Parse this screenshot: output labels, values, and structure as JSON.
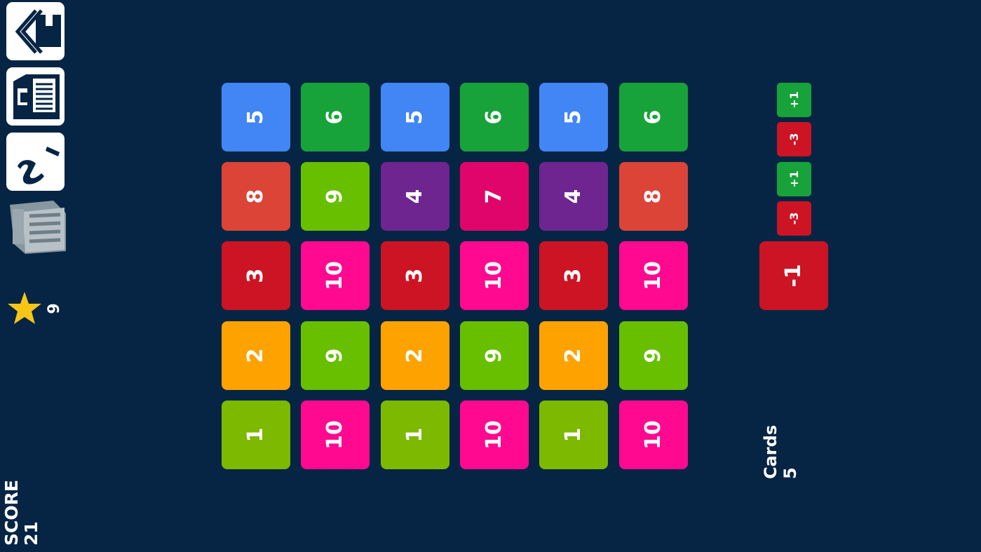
{
  "sidebar": {
    "home_icon": "home-icon",
    "save_icon": "save-icon",
    "info_icon": "info-icon",
    "trash_icon": "trash-icon",
    "star_icon": "star-icon",
    "stars_count": "9"
  },
  "score": {
    "label": "SCORE",
    "value": "21"
  },
  "cards": {
    "label": "Cards",
    "value": "5"
  },
  "colors": {
    "background": "#062544",
    "blue": "#4285f4",
    "green": "#17a339",
    "red_orange": "#db4437",
    "lime": "#67bf00",
    "purple": "#6f2590",
    "crimson": "#e0056b",
    "red": "#cc1425",
    "magenta": "#ff0991",
    "orange": "#fea200",
    "light_green": "#7cb900",
    "star": "#f5c518"
  },
  "grid": [
    [
      {
        "value": "5",
        "color": "#4285f4"
      },
      {
        "value": "6",
        "color": "#17a339"
      },
      {
        "value": "5",
        "color": "#4285f4"
      },
      {
        "value": "6",
        "color": "#17a339"
      },
      {
        "value": "5",
        "color": "#4285f4"
      },
      {
        "value": "6",
        "color": "#17a339"
      }
    ],
    [
      {
        "value": "8",
        "color": "#db4437"
      },
      {
        "value": "9",
        "color": "#67bf00"
      },
      {
        "value": "4",
        "color": "#6f2590"
      },
      {
        "value": "7",
        "color": "#e0056b"
      },
      {
        "value": "4",
        "color": "#6f2590"
      },
      {
        "value": "8",
        "color": "#db4437"
      }
    ],
    [
      {
        "value": "3",
        "color": "#cc1425"
      },
      {
        "value": "10",
        "color": "#ff0991"
      },
      {
        "value": "3",
        "color": "#cc1425"
      },
      {
        "value": "10",
        "color": "#ff0991"
      },
      {
        "value": "3",
        "color": "#cc1425"
      },
      {
        "value": "10",
        "color": "#ff0991"
      }
    ],
    [
      {
        "value": "2",
        "color": "#fea200"
      },
      {
        "value": "9",
        "color": "#67bf00"
      },
      {
        "value": "2",
        "color": "#fea200"
      },
      {
        "value": "9",
        "color": "#67bf00"
      },
      {
        "value": "2",
        "color": "#fea200"
      },
      {
        "value": "9",
        "color": "#67bf00"
      }
    ],
    [
      {
        "value": "1",
        "color": "#7cb900"
      },
      {
        "value": "10",
        "color": "#ff0991"
      },
      {
        "value": "1",
        "color": "#7cb900"
      },
      {
        "value": "10",
        "color": "#ff0991"
      },
      {
        "value": "1",
        "color": "#7cb900"
      },
      {
        "value": "10",
        "color": "#ff0991"
      }
    ]
  ],
  "queue": [
    {
      "value": "+1",
      "color": "#17a339"
    },
    {
      "value": "-3",
      "color": "#cc1425"
    },
    {
      "value": "+1",
      "color": "#17a339"
    },
    {
      "value": "-3",
      "color": "#cc1425"
    }
  ],
  "current_card": {
    "value": "-1",
    "color": "#cc1425"
  }
}
